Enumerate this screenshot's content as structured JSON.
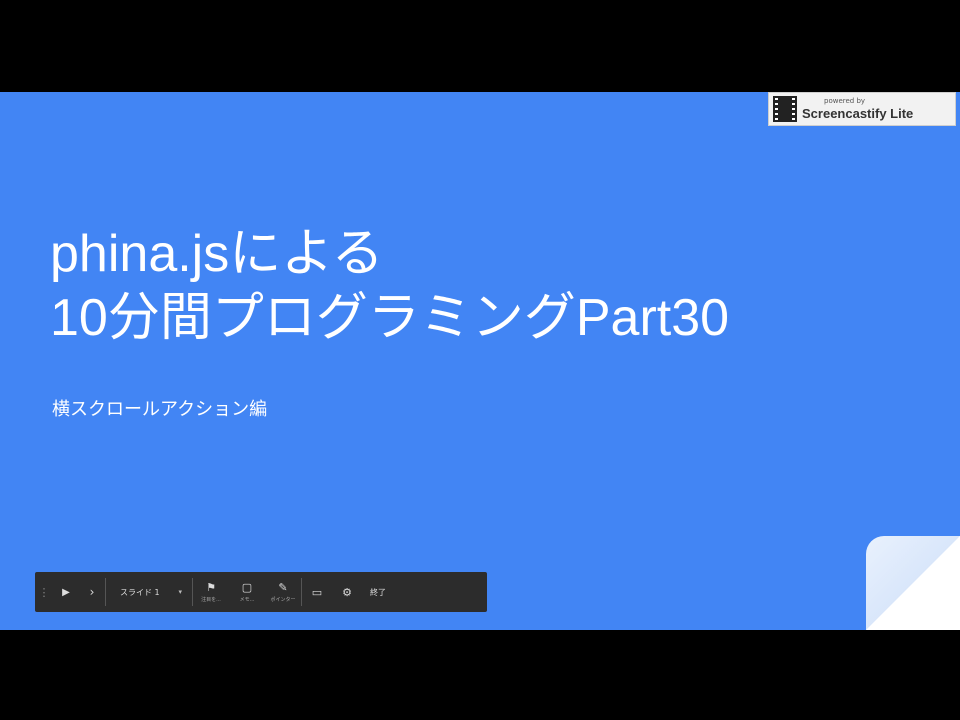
{
  "slide": {
    "title_line1": "phina.jsによる",
    "title_line2": "10分間プログラミングPart30",
    "subtitle": "横スクロールアクション編",
    "background_color": "#4285f4"
  },
  "watermark": {
    "small_text": "powered by",
    "brand_text": "Screencastify Lite"
  },
  "toolbar": {
    "menu_glyph": "⋮",
    "play_glyph": "▶",
    "next_glyph": "›",
    "slide_select_label": "スライド 1",
    "caret_glyph": "▾",
    "tools": [
      {
        "glyph": "⚑",
        "label": "注目を..."
      },
      {
        "glyph": "▢",
        "label": "メモ..."
      },
      {
        "glyph": "✎",
        "label": "ポインター"
      }
    ],
    "fullscreen_glyph": "▭",
    "settings_glyph": "⚙",
    "end_label": "終了"
  }
}
